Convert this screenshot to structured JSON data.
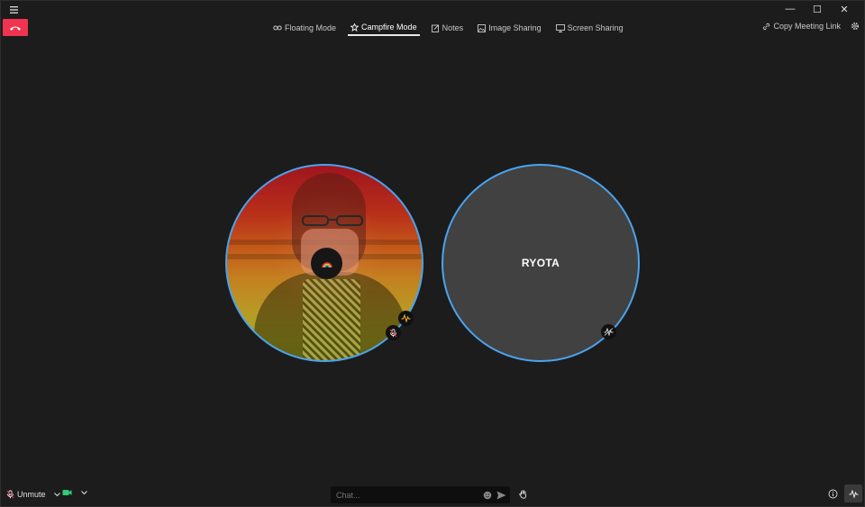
{
  "window": {
    "minimize_glyph": "—",
    "maximize_glyph": "☐",
    "close_glyph": "✕"
  },
  "nav": {
    "tabs": [
      {
        "label": "Floating Mode",
        "icon": "link-rings-icon",
        "active": false
      },
      {
        "label": "Campfire Mode",
        "icon": "campfire-icon",
        "active": true
      },
      {
        "label": "Notes",
        "icon": "notes-icon",
        "active": false
      },
      {
        "label": "Image Sharing",
        "icon": "image-icon",
        "active": false
      },
      {
        "label": "Screen Sharing",
        "icon": "monitor-icon",
        "active": false
      }
    ],
    "copy_link_label": "Copy Meeting Link"
  },
  "participants": [
    {
      "type": "camera",
      "status_icon": "audio-activity-icon",
      "mic_icon": "mic-muted-icon"
    },
    {
      "name": "RYOTA",
      "status_icon": "audio-idle-icon"
    }
  ],
  "bottom": {
    "unmute_label": "Unmute",
    "chat_placeholder": "Chat..."
  },
  "colors": {
    "hangup": "#f0334f",
    "ring": "#4aa3ef",
    "video_icon": "#2ecc71",
    "background": "#1c1c1c"
  }
}
